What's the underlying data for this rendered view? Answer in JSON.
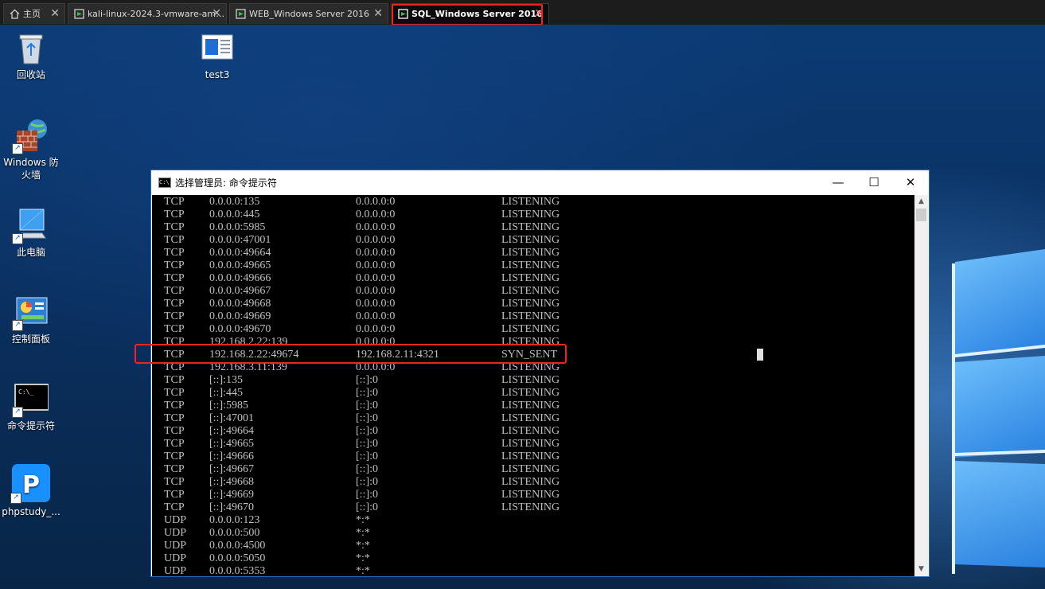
{
  "tabs": [
    {
      "label": "主页",
      "icon": "home-icon"
    },
    {
      "label": "kali-linux-2024.3-vmware-am…",
      "icon": "vm-icon"
    },
    {
      "label": "WEB_Windows Server 2016",
      "icon": "vm-icon"
    },
    {
      "label": "SQL_Windows Server 2016",
      "icon": "vm-icon",
      "active": true
    }
  ],
  "desktop_icons": [
    {
      "label": "回收站",
      "icon": "recycle-bin-icon"
    },
    {
      "label": "test3",
      "icon": "document-icon"
    },
    {
      "label": "Windows 防火墙",
      "icon": "firewall-icon"
    },
    {
      "label": "此电脑",
      "icon": "computer-icon"
    },
    {
      "label": "控制面板",
      "icon": "control-panel-icon"
    },
    {
      "label": "命令提示符",
      "icon": "cmd-icon"
    },
    {
      "label": "phpstudy_...",
      "icon": "phpstudy-icon"
    }
  ],
  "cmd_window": {
    "title": "选择管理员: 命令提示符",
    "icon_text": "C:\\",
    "buttons": {
      "minimize": "—",
      "maximize": "☐",
      "close": "✕"
    },
    "highlighted_row_index": 12,
    "rows": [
      {
        "proto": "TCP",
        "local": "0.0.0.0:135",
        "foreign": "0.0.0.0:0",
        "state": "LISTENING"
      },
      {
        "proto": "TCP",
        "local": "0.0.0.0:445",
        "foreign": "0.0.0.0:0",
        "state": "LISTENING"
      },
      {
        "proto": "TCP",
        "local": "0.0.0.0:5985",
        "foreign": "0.0.0.0:0",
        "state": "LISTENING"
      },
      {
        "proto": "TCP",
        "local": "0.0.0.0:47001",
        "foreign": "0.0.0.0:0",
        "state": "LISTENING"
      },
      {
        "proto": "TCP",
        "local": "0.0.0.0:49664",
        "foreign": "0.0.0.0:0",
        "state": "LISTENING"
      },
      {
        "proto": "TCP",
        "local": "0.0.0.0:49665",
        "foreign": "0.0.0.0:0",
        "state": "LISTENING"
      },
      {
        "proto": "TCP",
        "local": "0.0.0.0:49666",
        "foreign": "0.0.0.0:0",
        "state": "LISTENING"
      },
      {
        "proto": "TCP",
        "local": "0.0.0.0:49667",
        "foreign": "0.0.0.0:0",
        "state": "LISTENING"
      },
      {
        "proto": "TCP",
        "local": "0.0.0.0:49668",
        "foreign": "0.0.0.0:0",
        "state": "LISTENING"
      },
      {
        "proto": "TCP",
        "local": "0.0.0.0:49669",
        "foreign": "0.0.0.0:0",
        "state": "LISTENING"
      },
      {
        "proto": "TCP",
        "local": "0.0.0.0:49670",
        "foreign": "0.0.0.0:0",
        "state": "LISTENING"
      },
      {
        "proto": "TCP",
        "local": "192.168.2.22:139",
        "foreign": "0.0.0.0:0",
        "state": "LISTENING"
      },
      {
        "proto": "TCP",
        "local": "192.168.2.22:49674",
        "foreign": "192.168.2.11:4321",
        "state": "SYN_SENT"
      },
      {
        "proto": "TCP",
        "local": "192.168.3.11:139",
        "foreign": "0.0.0.0:0",
        "state": "LISTENING"
      },
      {
        "proto": "TCP",
        "local": "[::]:135",
        "foreign": "[::]:0",
        "state": "LISTENING"
      },
      {
        "proto": "TCP",
        "local": "[::]:445",
        "foreign": "[::]:0",
        "state": "LISTENING"
      },
      {
        "proto": "TCP",
        "local": "[::]:5985",
        "foreign": "[::]:0",
        "state": "LISTENING"
      },
      {
        "proto": "TCP",
        "local": "[::]:47001",
        "foreign": "[::]:0",
        "state": "LISTENING"
      },
      {
        "proto": "TCP",
        "local": "[::]:49664",
        "foreign": "[::]:0",
        "state": "LISTENING"
      },
      {
        "proto": "TCP",
        "local": "[::]:49665",
        "foreign": "[::]:0",
        "state": "LISTENING"
      },
      {
        "proto": "TCP",
        "local": "[::]:49666",
        "foreign": "[::]:0",
        "state": "LISTENING"
      },
      {
        "proto": "TCP",
        "local": "[::]:49667",
        "foreign": "[::]:0",
        "state": "LISTENING"
      },
      {
        "proto": "TCP",
        "local": "[::]:49668",
        "foreign": "[::]:0",
        "state": "LISTENING"
      },
      {
        "proto": "TCP",
        "local": "[::]:49669",
        "foreign": "[::]:0",
        "state": "LISTENING"
      },
      {
        "proto": "TCP",
        "local": "[::]:49670",
        "foreign": "[::]:0",
        "state": "LISTENING"
      },
      {
        "proto": "UDP",
        "local": "0.0.0.0:123",
        "foreign": "*:*",
        "state": ""
      },
      {
        "proto": "UDP",
        "local": "0.0.0.0:500",
        "foreign": "*:*",
        "state": ""
      },
      {
        "proto": "UDP",
        "local": "0.0.0.0:4500",
        "foreign": "*:*",
        "state": ""
      },
      {
        "proto": "UDP",
        "local": "0.0.0.0:5050",
        "foreign": "*:*",
        "state": ""
      },
      {
        "proto": "UDP",
        "local": "0.0.0.0:5353",
        "foreign": "*:*",
        "state": ""
      }
    ]
  },
  "colors": {
    "highlight_border": "#e8281e",
    "console_bg": "#000000",
    "console_text": "#c0c0c0"
  }
}
